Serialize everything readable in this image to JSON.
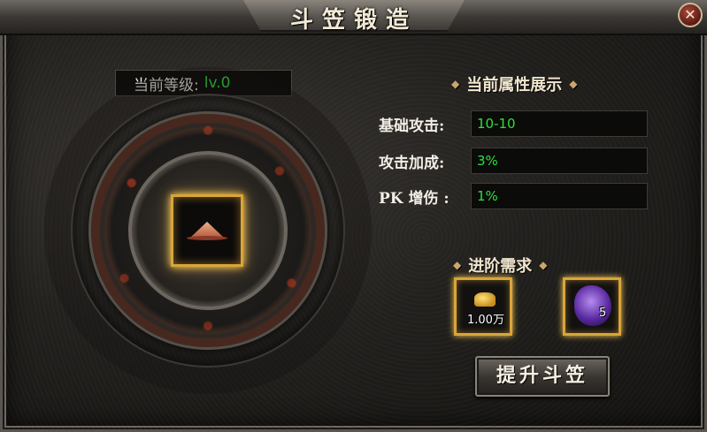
{
  "window": {
    "title": "斗笠锻造",
    "close_glyph": "✕"
  },
  "level": {
    "label": "当前等级:",
    "value": "lv.0"
  },
  "attributes": {
    "title": "当前属性展示",
    "items": [
      {
        "label": "基础攻击:",
        "value": "10-10"
      },
      {
        "label": "攻击加成:",
        "value": "3%"
      },
      {
        "label": "PK 增伤 :",
        "value": "1%"
      }
    ]
  },
  "requirements": {
    "title": "进阶需求",
    "items": [
      {
        "icon": "gold-coins-icon",
        "count": "1.00万"
      },
      {
        "icon": "purple-gem-icon",
        "count": "5"
      }
    ]
  },
  "actions": {
    "upgrade_label": "提升斗笠"
  },
  "colors": {
    "value_green": "#2ce03a",
    "slot_gold": "#d9a53a"
  }
}
